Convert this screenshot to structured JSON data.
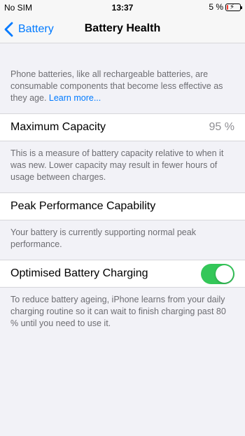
{
  "status_bar": {
    "carrier": "No SIM",
    "time": "13:37",
    "battery_percent": "5 %"
  },
  "nav": {
    "back_label": "Battery",
    "title": "Battery Health"
  },
  "intro": {
    "text": "Phone batteries, like all rechargeable batteries, are consumable components that become less effective as they age. ",
    "link": "Learn more..."
  },
  "max_capacity": {
    "label": "Maximum Capacity",
    "value": "95 %",
    "description": "This is a measure of battery capacity relative to when it was new. Lower capacity may result in fewer hours of usage between charges."
  },
  "peak_performance": {
    "label": "Peak Performance Capability",
    "description": "Your battery is currently supporting normal peak performance."
  },
  "optimised_charging": {
    "label": "Optimised Battery Charging",
    "enabled": true,
    "description": "To reduce battery ageing, iPhone learns from your daily charging routine so it can wait to finish charging past 80 % until you need to use it."
  },
  "colors": {
    "accent": "#007aff",
    "toggle_on": "#34c759",
    "battery_low": "#ff3b30"
  }
}
